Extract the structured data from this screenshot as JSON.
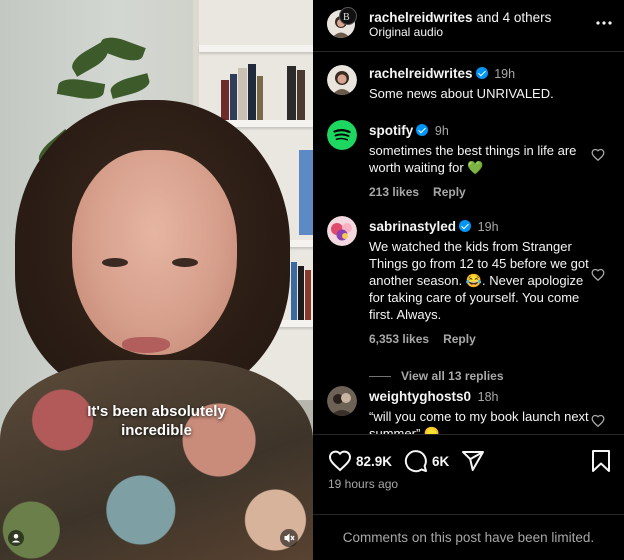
{
  "video": {
    "caption_line1": "It's been absolutely",
    "caption_line2": "incredible",
    "icons": [
      "profile-icon",
      "muted-speaker-icon"
    ]
  },
  "header": {
    "username": "rachelreidwrites",
    "and_others": " and 4 others",
    "audio": "Original audio",
    "more_icon": "more-icon"
  },
  "caption_post": {
    "username": "rachelreidwrites",
    "verified": true,
    "time": "19h",
    "text": "Some news about UNRIVALED."
  },
  "comments": [
    {
      "username": "spotify",
      "verified": true,
      "time": "9h",
      "text": "sometimes the best things in life are worth waiting for 💚",
      "likes": "213 likes",
      "reply": "Reply",
      "avatar_color": "#1ed760"
    },
    {
      "username": "sabrinastyled",
      "verified": true,
      "time": "19h",
      "text": "We watched the kids from Stranger Things go from 12 to 45 before we got another season. 😂. Never apologize for taking care of yourself. You come first. Always.",
      "likes": "6,353 likes",
      "reply": "Reply",
      "view_replies": "View all 13 replies",
      "avatar_color": "#e04b6b"
    },
    {
      "username": "weightyghosts0",
      "verified": false,
      "time": "18h",
      "text": "“will you come to my book launch next summer” 😞",
      "avatar_color": "#4b4038"
    }
  ],
  "actions": {
    "likes_count": "82.9K",
    "comments_count": "6K",
    "timestamp": "19 hours ago"
  },
  "footer": {
    "limited_text": "Comments on this post have been limited."
  },
  "colors": {
    "background": "#000000",
    "verified_blue": "#0095f6",
    "muted_text": "#a8a8a8",
    "divider": "#262626"
  }
}
